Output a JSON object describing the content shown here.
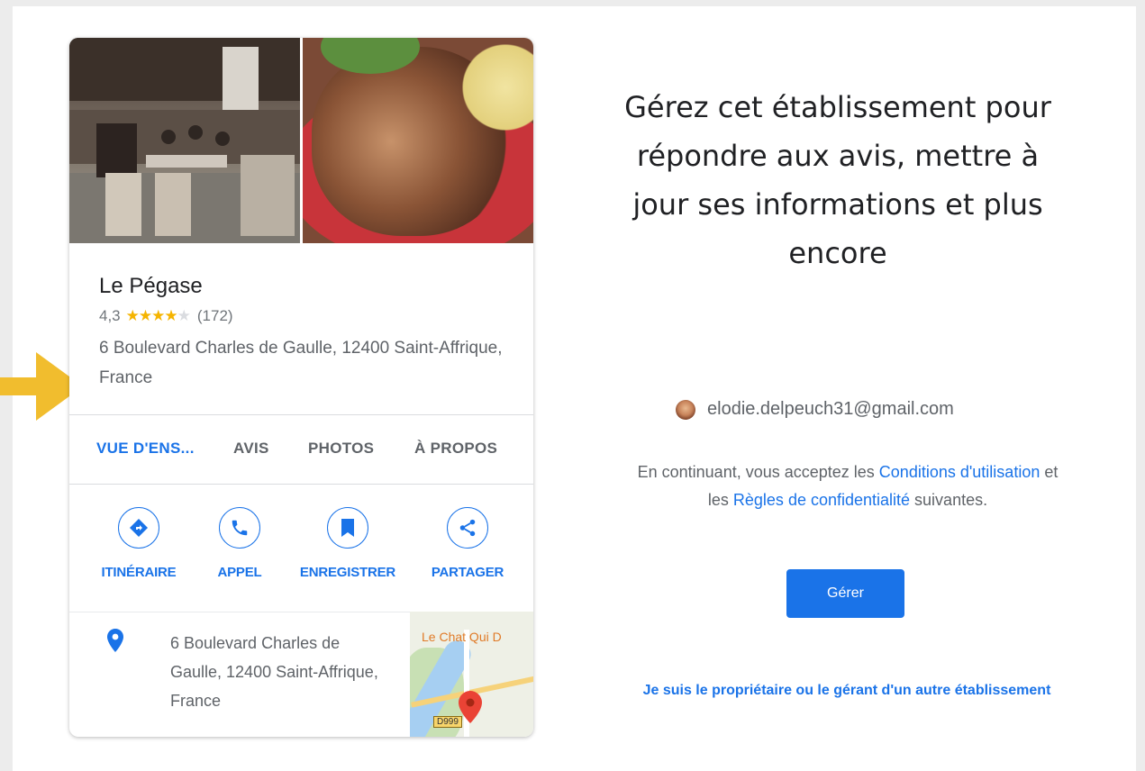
{
  "business": {
    "name": "Le Pégase",
    "rating": "4,3",
    "stars": 4.3,
    "review_count": "(172)",
    "address": "6 Boulevard Charles de Gaulle, 12400 Saint-Affrique, France"
  },
  "tabs": [
    "VUE D'ENS...",
    "AVIS",
    "PHOTOS",
    "À PROPOS"
  ],
  "actions": [
    {
      "label": "ITINÉRAIRE",
      "icon": "directions-icon"
    },
    {
      "label": "APPEL",
      "icon": "phone-icon"
    },
    {
      "label": "ENREGISTRER",
      "icon": "bookmark-icon"
    },
    {
      "label": "PARTAGER",
      "icon": "share-icon"
    }
  ],
  "location": {
    "address": "6 Boulevard Charles de Gaulle, 12400 Saint-Affrique, France",
    "map_label": "Le Chat Qui D",
    "road_label": "D999"
  },
  "manage": {
    "headline": "Gérez cet établissement pour répondre aux avis, mettre à jour ses informations et plus encore",
    "account_email": "elodie.delpeuch31@gmail.com",
    "terms_prefix": "En continuant, vous acceptez les ",
    "terms_link": "Conditions d'utilisation",
    "terms_middle": " et les ",
    "privacy_link": "Règles de confidentialité",
    "terms_suffix": " suivantes.",
    "button_label": "Gérer",
    "other_business_link": "Je suis le propriétaire ou le gérant d'un autre établissement"
  },
  "colors": {
    "accent": "#1a73e8",
    "star": "#f5b400",
    "arrow": "#f1bd2e"
  }
}
